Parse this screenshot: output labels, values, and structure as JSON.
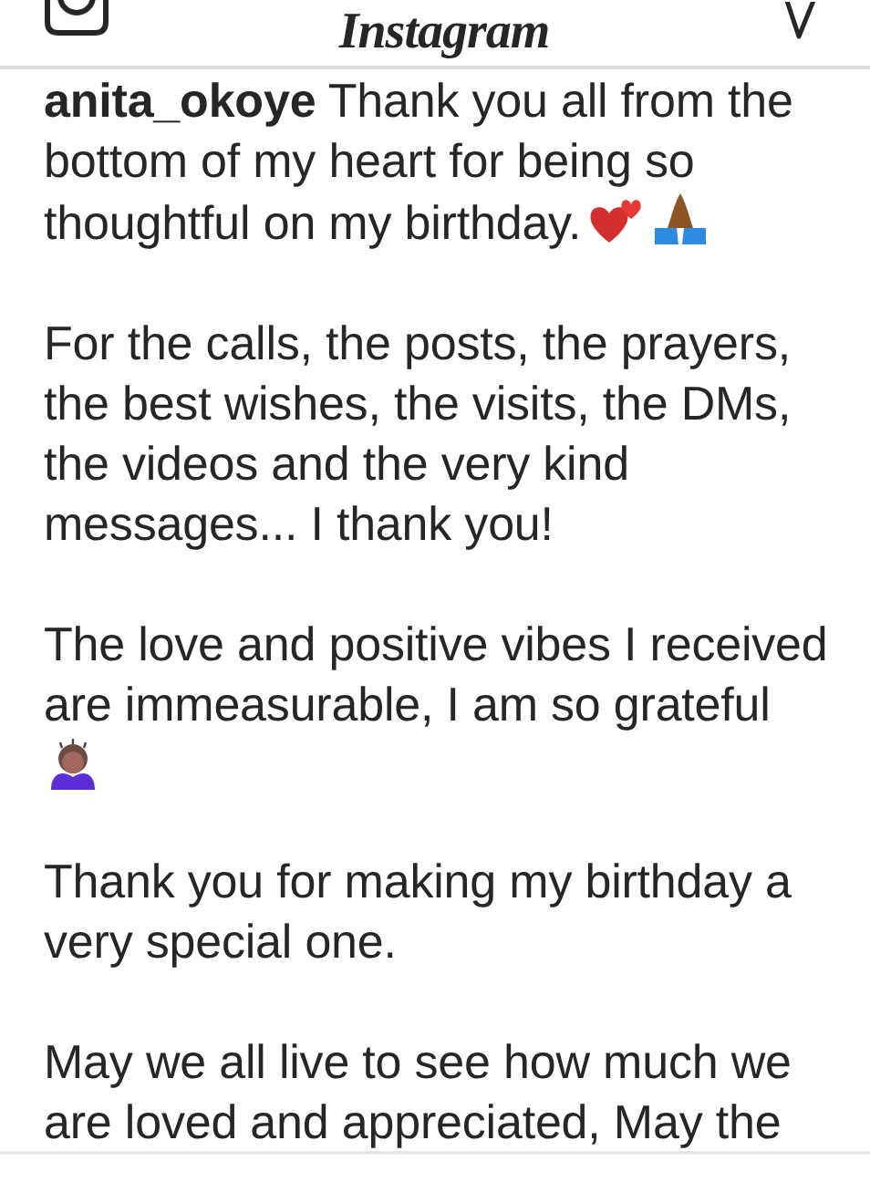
{
  "header": {
    "logo": "Instagram"
  },
  "post": {
    "paragraphs": [
      "**anita_okoye** Thank you all from the bottom of my heart for being so thoughtful on my birthday.",
      "For the calls, the posts, the prayers, the best wishes, the visits, the DMs, the videos and the very kind messages... I thank you!",
      "The love and positive vibes I received are immeasurable, I am so grateful",
      "Thank you for making my birthday a very special one.",
      "May we all live to see how much we are loved and appreciated, May the"
    ]
  }
}
